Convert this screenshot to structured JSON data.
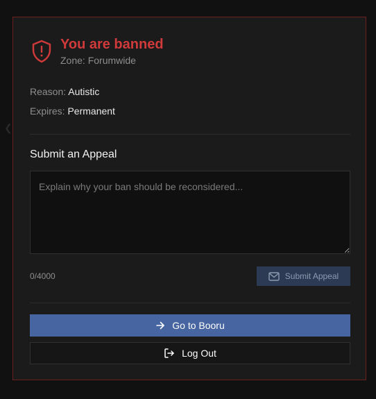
{
  "ban": {
    "title": "You are banned",
    "zone": "Zone: Forumwide",
    "reason_label": "Reason:",
    "reason_value": "Autistic",
    "expires_label": "Expires:",
    "expires_value": "Permanent",
    "icon": "shield-alert-icon"
  },
  "appeal": {
    "title": "Submit an Appeal",
    "placeholder": "Explain why your ban should be reconsidered...",
    "value": "",
    "counter": "0/4000",
    "submit_label": "Submit Appeal",
    "submit_icon": "mail-icon"
  },
  "actions": {
    "booru_label": "Go to Booru",
    "booru_icon": "arrow-right-icon",
    "logout_label": "Log Out",
    "logout_icon": "log-out-icon"
  },
  "colors": {
    "danger": "#d03a3a",
    "accent": "#4765a0",
    "accent_disabled": "#2d3a53",
    "card_bg": "#1b1b1c",
    "page_bg": "#111112"
  }
}
